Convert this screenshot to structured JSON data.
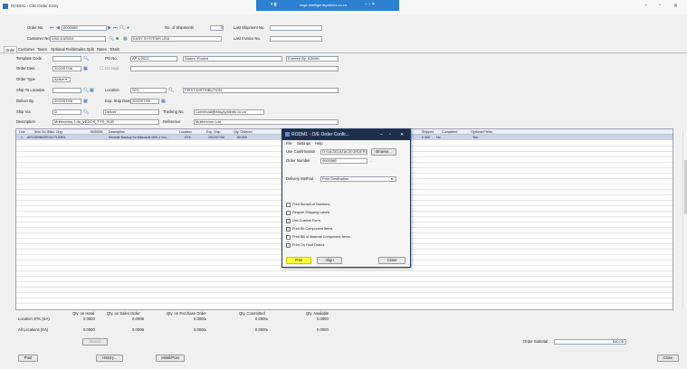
{
  "window": {
    "title": "RODM1 - O/E Order Entry",
    "taskbar_text": "sage.intelligentsystems.co.za"
  },
  "header": {
    "order_no_label": "Order No.",
    "order_no": "0000086",
    "customer_no_label": "Customer No.",
    "customer_no": "DSD-EAS004",
    "customer_name": "EASY SYSTEMS USA",
    "shipments_label": "No. of Shipments",
    "shipments": "0",
    "last_shipment_label": "Last Shipment No.",
    "last_shipment": "",
    "last_invoice_label": "Last Invoice No.",
    "last_invoice": ""
  },
  "tabs": [
    "Order",
    "Customer",
    "Taxes",
    "Optional Fields",
    "Sales Split",
    "Rates",
    "Totals"
  ],
  "form": {
    "template_code_label": "Template Code",
    "template_code": "",
    "po_no_label": "PO No.",
    "po_no": "AP 1/2022",
    "status": "Status: Posted",
    "entered_by": "Entered By: ADMIN",
    "order_date_label": "Order Date",
    "order_date": "2022/07/06",
    "on_hold_label": "On Hold",
    "order_type_label": "Order Type",
    "order_type": "Active",
    "ship_from_label": "Ship-To Location",
    "ship_from": "",
    "location_label": "Location",
    "location": "STK",
    "location_desc": "FIRST DISTRIBUTION",
    "deliver_by_label": "Deliver By",
    "deliver_by": "2022/07/06",
    "exp_ship_label": "Exp. Ship Date",
    "exp_ship": "2022/07/06",
    "ship_via_label": "Ship Via",
    "ship_via": "D",
    "ship_via_desc": "Deliver",
    "tracking_label": "Tracking No.",
    "tracking": "Comercial@easysystems.co.za",
    "description_label": "Description",
    "description": "Multienvios, Lda_VEDOS_TYR_SUB",
    "reference_label": "Reference",
    "reference": "Multienvios Lda"
  },
  "grid": {
    "headers": [
      "Line",
      "Item No./Misc. Chg.",
      "Kit/BOM",
      "Description",
      "Location",
      "Exp. Ship",
      "Qty. Ordered",
      "Shipped",
      "Completed",
      "Optional Fields"
    ],
    "row": [
      "1",
      "AP1000INDEEXIGTUOM1",
      "",
      "Remote Backup for Microsoft (MS-1 Vo)...",
      "STK",
      "2022/07/06",
      "80.000",
      "0.000",
      "No",
      "Yes"
    ]
  },
  "dialog": {
    "title": "RODM1 - O/E Order Confir...",
    "menu": [
      "File",
      "Settings",
      "Help"
    ],
    "use_confirmation_label": "Use Confirmation",
    "use_confirmation": "D:\\SAGEDATA\\OEORDERCFM.RPT",
    "browse_label": "Browse...",
    "order_number_label": "Order Number",
    "order_number": "0000086",
    "delivery_method_label": "Delivery Method",
    "delivery_method": "Print Destination",
    "options": [
      {
        "label": "Print Serial/Lot Numbers",
        "checked": false
      },
      {
        "label": "Require Shipping Labels",
        "checked": false
      },
      {
        "label": "Use Custom Form",
        "checked": true
      },
      {
        "label": "Print Kit Component Items",
        "checked": true
      },
      {
        "label": "Print Bill of Material Component Items",
        "checked": false
      },
      {
        "label": "Print On Hold Orders",
        "checked": true
      }
    ],
    "print_label": "Print",
    "align_label": "Align",
    "close_label": "Close"
  },
  "bottom": {
    "qty_on_hand_label": "Qty. on Hand",
    "qty_on_sales_label": "Qty. on Sales Order",
    "qty_on_po_label": "Qty. on Purchase Order",
    "qty_committed_label": "Qty. Committed",
    "qty_available_label": "Qty. Available",
    "location_row_label": "Location STK (EA)",
    "all_locations_label": "All Locations (EA)",
    "loc_on_hand": "0.0000",
    "loc_on_sales": "0.0000",
    "loc_on_po": "0.0000",
    "loc_committed": "0.0000",
    "loc_available": "0.0000",
    "all_on_hand": "0.0000",
    "all_on_sales": "0.0000",
    "all_on_po": "0.0000",
    "all_committed": "0.0000",
    "all_available": "0.0000",
    "search_label": "Search",
    "order_subtotal_label": "Order Subtotal",
    "order_subtotal": "540.05"
  },
  "footer": {
    "post_label": "Post",
    "history_label": "History...",
    "print_post_label": "eMail/Post",
    "close_label": "Close"
  },
  "colors": {
    "accent": "#2d7fd1",
    "dialog_title": "#1e2f4d",
    "print_highlight": "#ffff33",
    "selected_row": "#ccd4ea"
  }
}
